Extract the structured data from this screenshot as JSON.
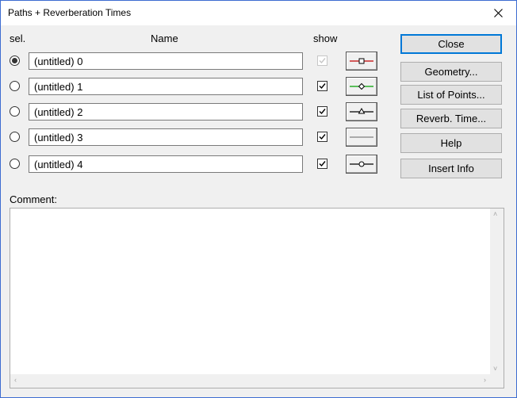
{
  "window": {
    "title": "Paths + Reverberation Times"
  },
  "headers": {
    "sel": "sel.",
    "name": "Name",
    "show": "show"
  },
  "rows": [
    {
      "name": "(untitled) 0",
      "selected": true,
      "show": true,
      "show_enabled": false,
      "line_color": "#c00000",
      "marker": "square"
    },
    {
      "name": "(untitled) 1",
      "selected": false,
      "show": true,
      "show_enabled": true,
      "line_color": "#00a000",
      "marker": "diamond"
    },
    {
      "name": "(untitled) 2",
      "selected": false,
      "show": true,
      "show_enabled": true,
      "line_color": "#000000",
      "marker": "triangle"
    },
    {
      "name": "(untitled) 3",
      "selected": false,
      "show": true,
      "show_enabled": true,
      "line_color": "#808080",
      "marker": "none"
    },
    {
      "name": "(untitled) 4",
      "selected": false,
      "show": true,
      "show_enabled": true,
      "line_color": "#000000",
      "marker": "circle"
    }
  ],
  "buttons": {
    "close": "Close",
    "geometry": "Geometry...",
    "list_of_points": "List of Points...",
    "reverb_time": "Reverb. Time...",
    "help": "Help",
    "insert_info": "Insert Info"
  },
  "comment": {
    "label": "Comment:",
    "value": ""
  }
}
